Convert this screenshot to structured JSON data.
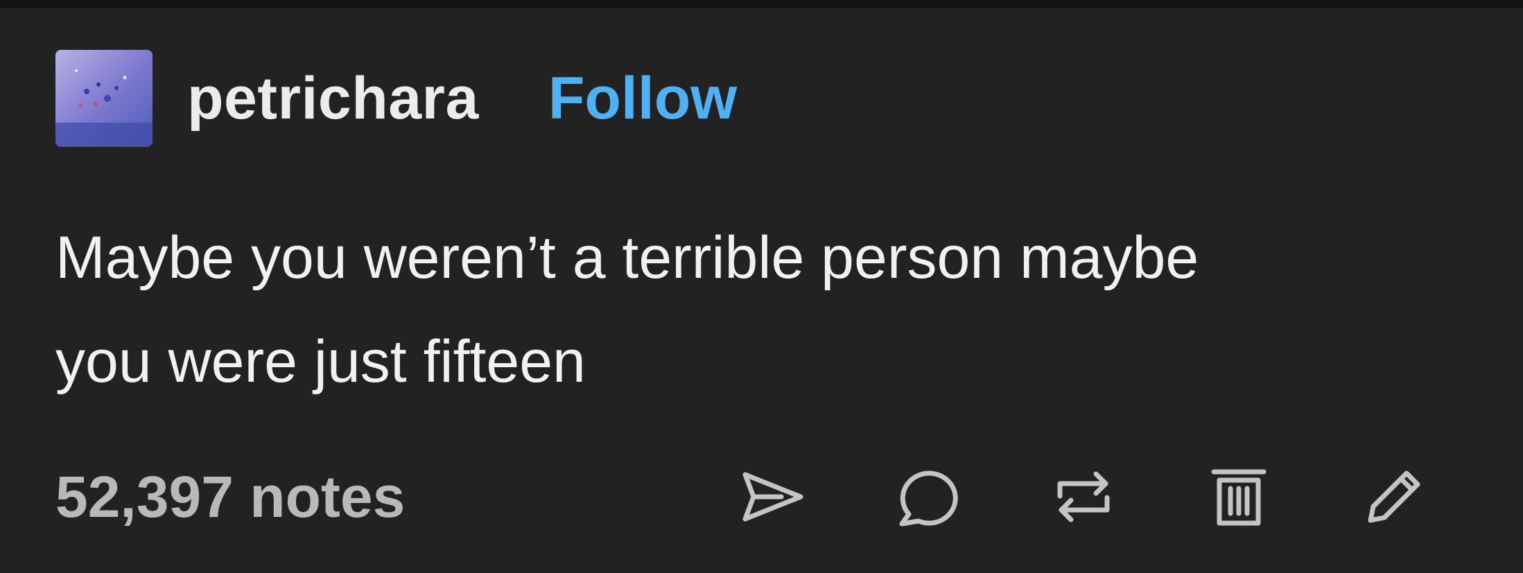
{
  "post": {
    "username": "petrichara",
    "follow_label": "Follow",
    "body_lines": [
      "Maybe you weren’t a terrible person maybe",
      "you were just fifteen"
    ],
    "notes_label": "52,397 notes"
  },
  "actions": [
    {
      "name": "share",
      "icon": "send-icon"
    },
    {
      "name": "reply",
      "icon": "comment-icon"
    },
    {
      "name": "reblog",
      "icon": "reblog-icon"
    },
    {
      "name": "delete",
      "icon": "trash-icon"
    },
    {
      "name": "edit",
      "icon": "pencil-icon"
    }
  ],
  "colors": {
    "background": "#222222",
    "follow": "#4fb1f3",
    "text": "#f1f1f1",
    "notes": "#b9b9b9",
    "icons": "#c4c4c4"
  }
}
